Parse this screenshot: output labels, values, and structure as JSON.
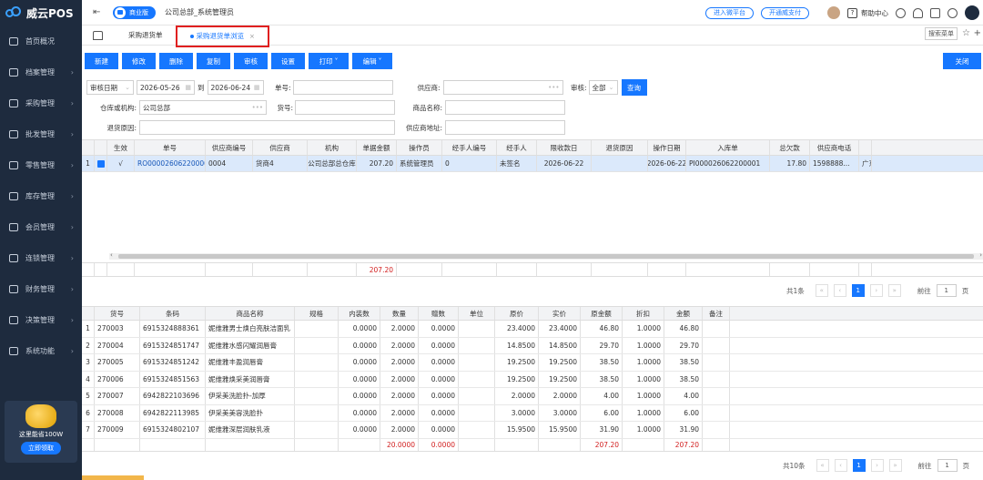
{
  "app": {
    "name": "威云POS",
    "edition": "商业版",
    "company": "公司总部_系统管理员"
  },
  "topbar": {
    "open_platform": "进入微平台",
    "open_pay": "开通威支付",
    "help": "帮助中心"
  },
  "sidebar": {
    "items": [
      "首页概况",
      "档案管理",
      "采购管理",
      "批发管理",
      "零售管理",
      "库存管理",
      "会员管理",
      "连锁管理",
      "财务管理",
      "决策管理",
      "系统功能"
    ],
    "promo": {
      "text": "这里能省100W",
      "button": "立即领取"
    }
  },
  "tabs": [
    {
      "label": "采购退货单"
    },
    {
      "label": "采购退货单浏览"
    }
  ],
  "search_menu": "搜索菜单",
  "toolbar": {
    "buttons": [
      "新建",
      "修改",
      "删除",
      "复制",
      "审核",
      "设置",
      "打印",
      "编辑"
    ],
    "close": "关闭"
  },
  "filters": {
    "date_type": "审核日期",
    "date_from": "2026-05-26",
    "to": "到",
    "date_to": "2026-06-24",
    "order_no": "单号:",
    "supplier": "供应商:",
    "audit": "审核:",
    "audit_value": "全部",
    "query": "查询",
    "warehouse": "仓库或机构:",
    "warehouse_value": "公司总部",
    "goods_no": "货号:",
    "goods_name": "商品名称:",
    "reason": "退货原因:",
    "supplier_addr": "供应商地址:"
  },
  "grid1": {
    "headers": [
      "生效",
      "单号",
      "供应商编号",
      "供应商",
      "机构",
      "单据金额",
      "操作员",
      "经手人编号",
      "经手人",
      "限收款日",
      "退货原因",
      "操作日期",
      "入库单",
      "总欠款",
      "供应商电话"
    ],
    "rows": [
      {
        "idx": "1",
        "valid": "√",
        "order": "RO000026062200001",
        "sup_no": "0004",
        "sup": "货商4",
        "org": "公司总部总仓库",
        "amount": "207.20",
        "operator": "系统管理员",
        "handler_no": "0",
        "handler": "未签名",
        "due": "2026-06-22",
        "reason": "",
        "op_date": "2026-06-22",
        "in_order": "PI000026062200001",
        "debt": "17.80",
        "phone": "1598888...",
        "extra": "广东"
      }
    ],
    "sum_amount": "207.20",
    "pager": {
      "total": "共1条",
      "page": "1",
      "goto": "前往",
      "goto_value": "1",
      "page_unit": "页"
    }
  },
  "grid2": {
    "headers": [
      "货号",
      "条码",
      "商品名称",
      "规格",
      "内装数",
      "数量",
      "赠数",
      "单位",
      "原价",
      "实价",
      "原金额",
      "折扣",
      "金额",
      "备注"
    ],
    "rows": [
      {
        "idx": "1",
        "no": "270003",
        "bar": "6915324888361",
        "name": "妮维雅男士焕白亮肤洁面乳",
        "spec": "",
        "pack": "0.0000",
        "qty": "2.0000",
        "gift": "0.0000",
        "unit": "",
        "orig": "23.4000",
        "real": "23.4000",
        "orig_amt": "46.80",
        "disc": "1.0000",
        "amt": "46.80",
        "memo": ""
      },
      {
        "idx": "2",
        "no": "270004",
        "bar": "6915324851747",
        "name": "妮维雅水感闪耀润唇膏",
        "spec": "",
        "pack": "0.0000",
        "qty": "2.0000",
        "gift": "0.0000",
        "unit": "",
        "orig": "14.8500",
        "real": "14.8500",
        "orig_amt": "29.70",
        "disc": "1.0000",
        "amt": "29.70",
        "memo": ""
      },
      {
        "idx": "3",
        "no": "270005",
        "bar": "6915324851242",
        "name": "妮维雅丰盈润唇膏",
        "spec": "",
        "pack": "0.0000",
        "qty": "2.0000",
        "gift": "0.0000",
        "unit": "",
        "orig": "19.2500",
        "real": "19.2500",
        "orig_amt": "38.50",
        "disc": "1.0000",
        "amt": "38.50",
        "memo": ""
      },
      {
        "idx": "4",
        "no": "270006",
        "bar": "6915324851563",
        "name": "妮维雅焕采美润唇膏",
        "spec": "",
        "pack": "0.0000",
        "qty": "2.0000",
        "gift": "0.0000",
        "unit": "",
        "orig": "19.2500",
        "real": "19.2500",
        "orig_amt": "38.50",
        "disc": "1.0000",
        "amt": "38.50",
        "memo": ""
      },
      {
        "idx": "5",
        "no": "270007",
        "bar": "6942822103696",
        "name": "伊采美洗脸扑-加厚",
        "spec": "",
        "pack": "0.0000",
        "qty": "2.0000",
        "gift": "0.0000",
        "unit": "",
        "orig": "2.0000",
        "real": "2.0000",
        "orig_amt": "4.00",
        "disc": "1.0000",
        "amt": "4.00",
        "memo": ""
      },
      {
        "idx": "6",
        "no": "270008",
        "bar": "6942822113985",
        "name": "伊采美美容洗脸扑",
        "spec": "",
        "pack": "0.0000",
        "qty": "2.0000",
        "gift": "0.0000",
        "unit": "",
        "orig": "3.0000",
        "real": "3.0000",
        "orig_amt": "6.00",
        "disc": "1.0000",
        "amt": "6.00",
        "memo": ""
      },
      {
        "idx": "7",
        "no": "270009",
        "bar": "6915324802107",
        "name": "妮维雅深层润肤乳液",
        "spec": "",
        "pack": "0.0000",
        "qty": "2.0000",
        "gift": "0.0000",
        "unit": "",
        "orig": "15.9500",
        "real": "15.9500",
        "orig_amt": "31.90",
        "disc": "1.0000",
        "amt": "31.90",
        "memo": ""
      }
    ],
    "sum": {
      "qty": "20.0000",
      "gift": "0.0000",
      "orig_amt": "207.20",
      "amt": "207.20"
    },
    "pager": {
      "total": "共10条",
      "page": "1",
      "goto": "前往",
      "goto_value": "1",
      "page_unit": "页"
    }
  }
}
